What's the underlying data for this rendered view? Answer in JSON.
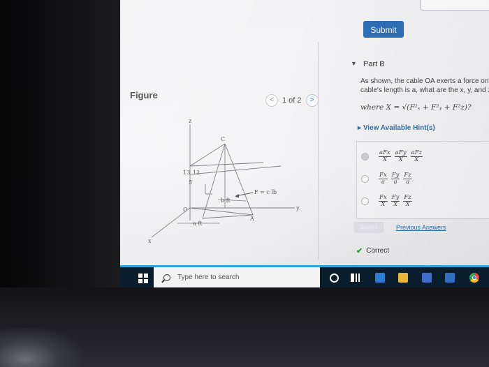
{
  "header": {
    "submit_label": "Submit"
  },
  "figure": {
    "label": "Figure",
    "pager_text": "1 of 2",
    "diagram_labels": {
      "z": "z",
      "c": "C",
      "n13": "13",
      "n12": "12",
      "n5": "5",
      "force": "F = c lb",
      "b_ft": "b ft",
      "o": "O",
      "a_pt": "A",
      "y": "y",
      "a_ft": "a ft",
      "x": "x"
    }
  },
  "part_b": {
    "title": "Part B",
    "question_line1": "As shown, the cable OA exerts a force on",
    "question_line2": "cable's length is a, what are the x, y, and z",
    "formula": "where X = √(F²ₓ + F²ᵧ + F²z)?",
    "hints_label": "View Available Hint(s)",
    "options": [
      {
        "num": [
          "aFx",
          "aFy",
          "aFz"
        ],
        "den": [
          "X",
          "X",
          "X"
        ],
        "sep": ","
      },
      {
        "num": [
          "Fx",
          "Fy",
          "Fz"
        ],
        "den": [
          "a",
          "a",
          "a"
        ],
        "sep": ","
      },
      {
        "num": [
          "Fx",
          "Fy",
          "Fz"
        ],
        "den": [
          "X",
          "X",
          "X"
        ],
        "sep": ","
      }
    ],
    "submit_label": "Submit",
    "previous_answers": "Previous Answers",
    "correct_label": "Correct"
  },
  "taskbar": {
    "search_placeholder": "Type here to search"
  },
  "colors": {
    "accent": "#2e6fb8",
    "correct": "#2f9a3f",
    "taskbar": "#0a1d2c"
  },
  "icons": [
    "windows-logo-icon",
    "search-icon",
    "cortana-icon",
    "task-view-icon",
    "edge-icon",
    "file-explorer-icon",
    "store-icon",
    "mail-icon",
    "chrome-icon",
    "chevron-left-icon",
    "chevron-right-icon",
    "caret-down-icon",
    "caret-right-icon",
    "checkmark-icon"
  ]
}
